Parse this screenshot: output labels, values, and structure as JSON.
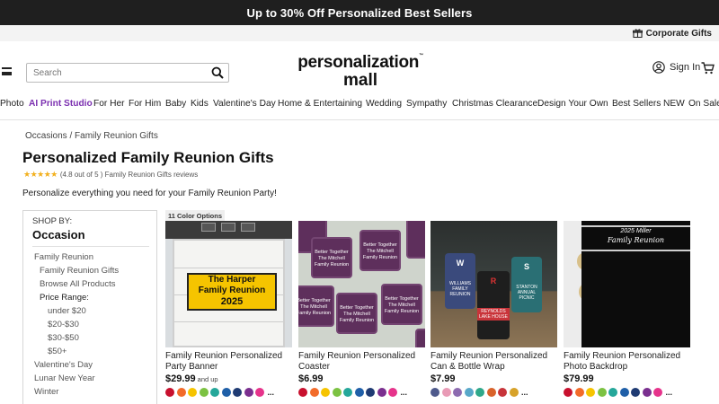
{
  "promo": {
    "text": "Up to 30% Off Personalized Best Sellers"
  },
  "corporate": {
    "label": "Corporate Gifts"
  },
  "header": {
    "search_placeholder": "Search",
    "logo_line1": "personalization",
    "logo_line2": "mall",
    "signin": "Sign In"
  },
  "nav": [
    "Photo",
    "AI Print Studio",
    "For Her",
    "For Him",
    "Baby",
    "Kids",
    "Valentine's Day",
    "Home & Entertaining",
    "Wedding",
    "Sympathy",
    "Christmas Clearance",
    "Design Your Own",
    "Best Sellers",
    "NEW",
    "On Sale"
  ],
  "breadcrumb": {
    "l1": "Occasions",
    "sep": "/",
    "l2": "Family Reunion Gifts"
  },
  "page": {
    "title": "Personalized Family Reunion Gifts",
    "rating_text": "(4.8 out of 5 ) Family Reunion Gifts reviews",
    "rating_value": 4.8,
    "description": "Personalize everything you need for your Family Reunion Party!"
  },
  "sidebar": {
    "shop_by": "SHOP BY:",
    "heading": "Occasion",
    "items": [
      {
        "label": "Family Reunion",
        "level": 1
      },
      {
        "label": "Family Reunion Gifts",
        "level": 2
      },
      {
        "label": "Browse All Products",
        "level": 2
      },
      {
        "label": "Price Range:",
        "level": 0
      },
      {
        "label": "under $20",
        "level": 3
      },
      {
        "label": "$20-$30",
        "level": 3
      },
      {
        "label": "$30-$50",
        "level": 3
      },
      {
        "label": "$50+",
        "level": 3
      },
      {
        "label": "Valentine's Day",
        "level": 1
      },
      {
        "label": "Lunar New Year",
        "level": 1
      },
      {
        "label": "Winter",
        "level": 1
      }
    ]
  },
  "products": [
    {
      "badge": "11 Color Options",
      "name": "Family Reunion Personalized Party Banner",
      "price": "$29.99",
      "price_note": "and up",
      "image_text": {
        "l1": "The Harper",
        "l2": "Family Reunion",
        "l3": "2025"
      },
      "swatches": [
        "#c8102e",
        "#f26b2a",
        "#f6c400",
        "#7cc242",
        "#25a79a",
        "#1f5fa8",
        "#1f3b73",
        "#7a2f8f",
        "#e6338b"
      ]
    },
    {
      "badge": "",
      "name": "Family Reunion Personalized Coaster",
      "price": "$6.99",
      "price_note": "",
      "image_text": {
        "l1": "Better Together",
        "l2": "The Mitchell",
        "l3": "Family Reunion"
      },
      "swatches": [
        "#c8102e",
        "#f26b2a",
        "#f6c400",
        "#7cc242",
        "#25a79a",
        "#1f5fa8",
        "#1f3b73",
        "#7a2f8f",
        "#e6338b"
      ]
    },
    {
      "badge": "",
      "name": "Family Reunion Personalized Can & Bottle Wrap",
      "price": "$7.99",
      "price_note": "",
      "image_text": {
        "a": "WILLIAMS FAMILY REUNION",
        "b": "REYNOLDS LAKE HOUSE",
        "c": "STANTON ANNUAL PICNIC",
        "m1": "W",
        "m2": "R",
        "m3": "S"
      },
      "swatches": [
        "#4e5a8c",
        "#e99bb6",
        "#8d6bb0",
        "#58a8c9",
        "#2fa88a",
        "#d9632b",
        "#c7343a",
        "#d7a22a"
      ]
    },
    {
      "badge": "",
      "name": "Family Reunion Personalized Photo Backdrop",
      "price": "$79.99",
      "price_note": "",
      "image_text": {
        "l1": "2025 Miller",
        "l2": "Family Reunion"
      },
      "swatches": [
        "#c8102e",
        "#f26b2a",
        "#f6c400",
        "#7cc242",
        "#25a79a",
        "#1f5fa8",
        "#1f3b73",
        "#7a2f8f",
        "#e6338b"
      ]
    }
  ],
  "more_label": "..."
}
